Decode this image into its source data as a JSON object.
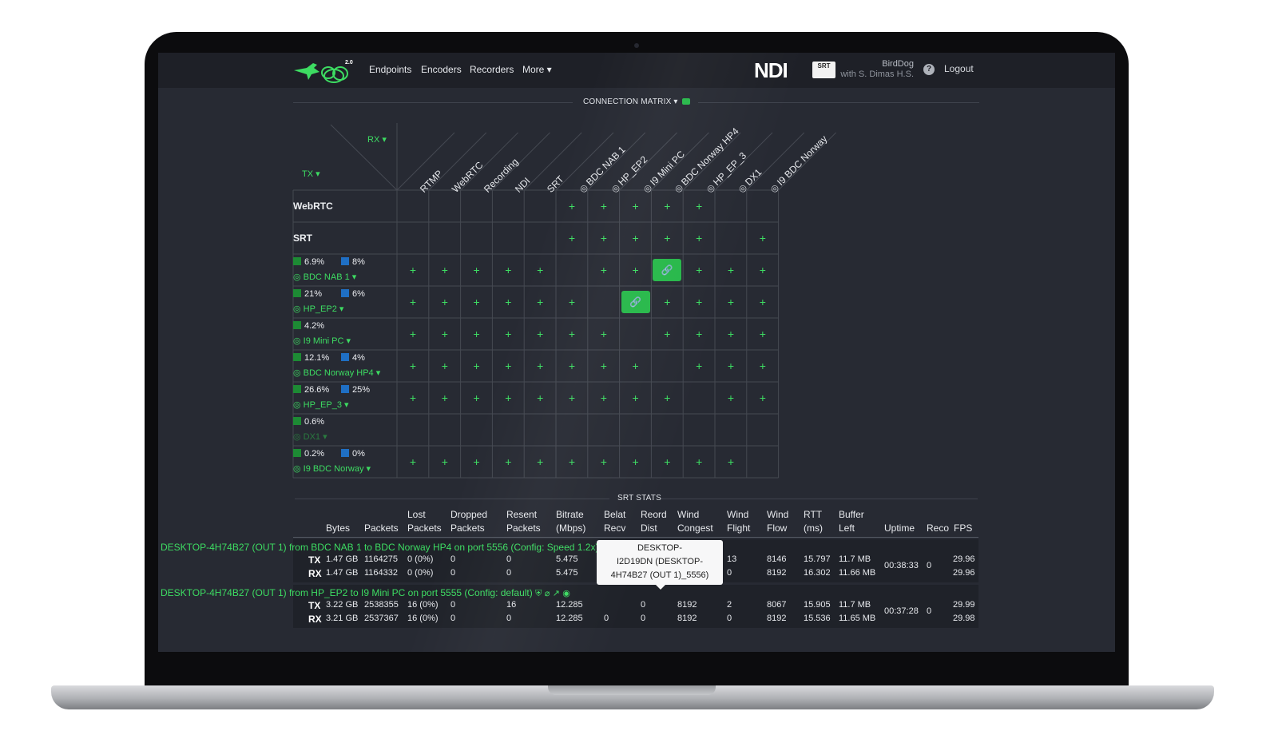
{
  "nav": {
    "version": "2.0",
    "items": [
      "Endpoints",
      "Encoders",
      "Recorders",
      "More ▾"
    ],
    "ndi": "NDI",
    "srt_logo": "SRT",
    "user_name": "BirdDog",
    "user_sub": "with S. Dimas H.S.",
    "help": "?",
    "logout": "Logout"
  },
  "matrix": {
    "title": "CONNECTION MATRIX ▾",
    "rx_label": "RX ▾",
    "tx_label": "TX ▾",
    "columns": [
      {
        "label": "RTMP",
        "icon": ""
      },
      {
        "label": "WebRTC",
        "icon": ""
      },
      {
        "label": "Recording",
        "icon": ""
      },
      {
        "label": "NDI",
        "icon": ""
      },
      {
        "label": "SRT",
        "icon": ""
      },
      {
        "label": "BDC NAB 1",
        "icon": "globe-icon"
      },
      {
        "label": "HP_EP2",
        "icon": "globe-icon"
      },
      {
        "label": "I9 Mini PC",
        "icon": "globe-icon"
      },
      {
        "label": "BDC Norway HP4",
        "icon": "globe-icon"
      },
      {
        "label": "HP_EP_3",
        "icon": "network-icon"
      },
      {
        "label": "DX1",
        "icon": "shuffle-globe-icon"
      },
      {
        "label": "I9 BDC Norway",
        "icon": "globe-icon"
      }
    ],
    "rows": [
      {
        "type": "plain",
        "label": "WebRTC",
        "cells": "-----+++++--"
      },
      {
        "type": "plain",
        "label": "SRT",
        "cells": "-----+++++-+"
      },
      {
        "type": "device",
        "tx": "6.9%",
        "rx": "8%",
        "name": "BDC NAB 1 ▾",
        "icon": "globe-icon",
        "cells": "+++++-++L+++"
      },
      {
        "type": "device",
        "tx": "21%",
        "rx": "6%",
        "name": "HP_EP2 ▾",
        "icon": "globe-icon",
        "cells": "++++++-L++++"
      },
      {
        "type": "device",
        "tx": "4.2%",
        "rx": "",
        "name": "I9 Mini PC ▾",
        "icon": "globe-icon",
        "cells": "+++++++-++++"
      },
      {
        "type": "device",
        "tx": "12.1%",
        "rx": "4%",
        "name": "BDC Norway HP4 ▾",
        "icon": "globe-icon",
        "cells": "++++++++-+++"
      },
      {
        "type": "device",
        "tx": "26.6%",
        "rx": "25%",
        "name": "HP_EP_3 ▾",
        "icon": "network-icon",
        "cells": "+++++++++-++"
      },
      {
        "type": "device",
        "tx": "0.6%",
        "rx": "",
        "name": "DX1 ▾",
        "icon": "shuffle-globe-icon",
        "dim": true,
        "cells": "------------"
      },
      {
        "type": "device",
        "tx": "0.2%",
        "rx": "0%",
        "name": "I9 BDC Norway ▾",
        "icon": "globe-icon",
        "cells": "+++++++++++-"
      }
    ],
    "plus": "+",
    "link": "🔗"
  },
  "stats": {
    "title": "SRT STATS",
    "headers": [
      [
        "Bytes"
      ],
      [
        "Packets"
      ],
      [
        "Lost",
        "Packets"
      ],
      [
        "Dropped",
        "Packets"
      ],
      [
        "Resent",
        "Packets"
      ],
      [
        "Bitrate",
        "(Mbps)"
      ],
      [
        "Belat",
        "Recv"
      ],
      [
        "Reord",
        "Dist"
      ],
      [
        "Wind",
        "Congest"
      ],
      [
        "Wind",
        "Flight"
      ],
      [
        "Wind",
        "Flow"
      ],
      [
        "RTT",
        "(ms)"
      ],
      [
        "Buffer",
        "Left"
      ],
      [
        "Uptime"
      ],
      [
        "Reco"
      ],
      [
        "FPS"
      ]
    ],
    "groups": [
      {
        "title": "DESKTOP-4H74B27 (OUT 1) from BDC NAB 1 to BDC Norway HP4 on port 5556 (Config: Speed 1.2x) NVENC VBR)",
        "uptime": "00:38:33",
        "reco": "0",
        "rows": [
          {
            "dir": "TX",
            "vals": [
              "1.47 GB",
              "1164275",
              "0 (0%)",
              "0",
              "0",
              "5.475",
              "",
              "",
              "",
              "13",
              "8146",
              "15.797",
              "11.7 MB"
            ],
            "fps": "29.96"
          },
          {
            "dir": "RX",
            "vals": [
              "1.47 GB",
              "1164332",
              "0 (0%)",
              "0",
              "0",
              "5.475",
              "",
              "",
              "",
              "0",
              "8192",
              "16.302",
              "11.66 MB"
            ],
            "fps": "29.96"
          }
        ]
      },
      {
        "title": "DESKTOP-4H74B27 (OUT 1) from HP_EP2 to I9 Mini PC on port 5555 (Config: default)",
        "uptime": "00:37:28",
        "reco": "0",
        "rows": [
          {
            "dir": "TX",
            "vals": [
              "3.22 GB",
              "2538355",
              "16 (0%)",
              "0",
              "16",
              "12.285",
              "",
              "0",
              "8192",
              "2",
              "8067",
              "15.905",
              "11.7 MB"
            ],
            "fps": "29.99"
          },
          {
            "dir": "RX",
            "vals": [
              "3.21 GB",
              "2537367",
              "16 (0%)",
              "0",
              "0",
              "12.285",
              "0",
              "0",
              "8192",
              "0",
              "8192",
              "15.536",
              "11.65 MB"
            ],
            "fps": "29.98"
          }
        ]
      }
    ],
    "tooltip": [
      "DESKTOP-",
      "I2D19DN (DESKTOP-",
      "4H74B27 (OUT 1)_5556)"
    ]
  }
}
